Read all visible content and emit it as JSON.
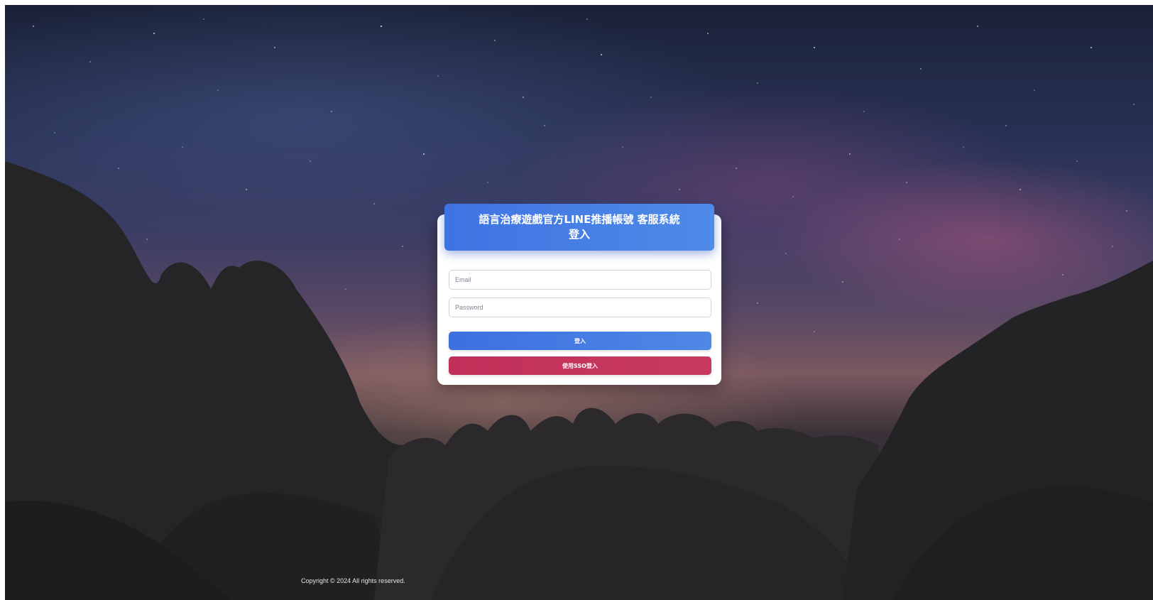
{
  "header": {
    "title_line1": "語言治療遊戲官方LINE推播帳號 客服系統",
    "title_line2": "登入"
  },
  "form": {
    "email": {
      "placeholder": "Email",
      "value": ""
    },
    "password": {
      "placeholder": "Password",
      "value": ""
    },
    "login_label": "登入",
    "sso_label": "使用SSO登入"
  },
  "footer": {
    "copyright": "Copyright © 2024 All rights reserved."
  },
  "colors": {
    "header_blue": "#4a7fe6",
    "login_blue": "#4679e3",
    "sso_red": "#c5345c",
    "card_white": "#ffffff"
  }
}
